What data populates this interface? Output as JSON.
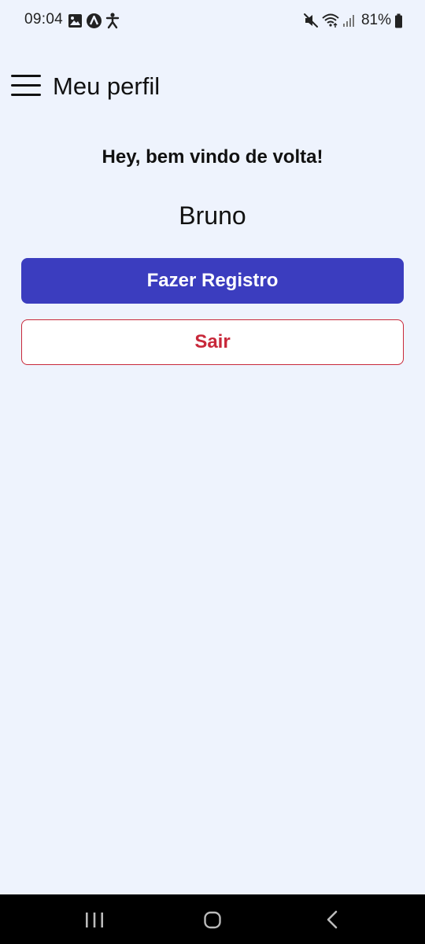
{
  "status_bar": {
    "time": "09:04",
    "battery": "81%",
    "left_icons": [
      "image-icon",
      "app-icon",
      "accessibility-icon"
    ],
    "right_icons": [
      "mute-icon",
      "wifi-icon",
      "signal-icon",
      "battery-icon"
    ]
  },
  "header": {
    "title": "Meu perfil",
    "menu_icon": "hamburger-menu-icon"
  },
  "profile": {
    "greeting": "Hey, bem vindo de volta!",
    "name": "Bruno"
  },
  "actions": {
    "register_label": "Fazer Registro",
    "logout_label": "Sair"
  },
  "colors": {
    "background": "#eef3fd",
    "primary": "#3b3dbf",
    "danger": "#c8283a"
  },
  "nav_bar": {
    "icons": [
      "recent-apps-icon",
      "home-icon",
      "back-icon"
    ]
  }
}
